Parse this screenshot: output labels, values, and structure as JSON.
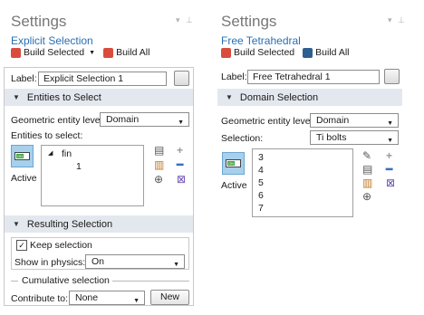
{
  "left": {
    "title": "Settings",
    "subtitle": "Explicit Selection",
    "toolbar": {
      "build_selected": "Build Selected",
      "build_all": "Build All"
    },
    "label_caption": "Label:",
    "label_value": "Explicit Selection 1",
    "entities_section": "Entities to Select",
    "geom_level_caption": "Geometric entity level:",
    "geom_level_value": "Domain",
    "entities_caption": "Entities to select:",
    "tree": {
      "parent": "fin",
      "child": "1"
    },
    "active_label": "Active",
    "resulting_section": "Resulting Selection",
    "keep_selection": "Keep selection",
    "show_in_physics_caption": "Show in physics:",
    "show_in_physics_value": "On",
    "cumulative_caption": "Cumulative selection",
    "contribute_caption": "Contribute to:",
    "contribute_value": "None",
    "new_button": "New"
  },
  "right": {
    "title": "Settings",
    "subtitle": "Free Tetrahedral",
    "toolbar": {
      "build_selected": "Build Selected",
      "build_all": "Build All"
    },
    "label_caption": "Label:",
    "label_value": "Free Tetrahedral 1",
    "domain_section": "Domain Selection",
    "geom_level_caption": "Geometric entity level:",
    "geom_level_value": "Domain",
    "selection_caption": "Selection:",
    "selection_value": "Ti bolts",
    "domains": [
      "3",
      "4",
      "5",
      "6",
      "7"
    ],
    "active_label": "Active"
  },
  "icons": {
    "pin": "pin-icon",
    "build_selected": "build-selected-icon",
    "build_all": "build-all-icon",
    "edit_label": "edit-label-icon",
    "toggle": "active-toggle-icon",
    "paste": "paste-icon",
    "copy": "copy-icon",
    "zoom": "zoom-to-selection-icon",
    "add": "add-icon",
    "remove": "remove-icon",
    "clear": "clear-selection-icon",
    "pick": "pick-icon"
  },
  "colors": {
    "accent_blue": "#2a6fb0",
    "section_bg": "#e3e8ef",
    "toggle_bg": "#a7d0ec",
    "on_green": "#44a344",
    "add_green": "#2e9a2e",
    "remove_blue": "#3b6fbf"
  }
}
